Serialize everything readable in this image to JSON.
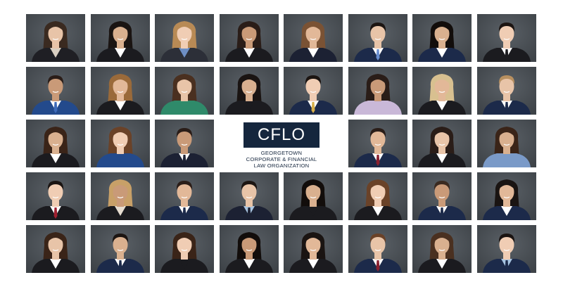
{
  "logo": {
    "wordmark": "CFLO",
    "subtitle_lines": [
      "GEORGETOWN",
      "CORPORATE & FINANCIAL",
      "LAW ORGANIZATION"
    ],
    "box_color": "#15263d"
  },
  "background_color": "#4b5157",
  "headshots": [
    {
      "hair": "#3a2a20",
      "hairStyle": "long",
      "suit": "#1f1f24",
      "shirt": "#d9cfc2",
      "tie": null
    },
    {
      "hair": "#1a1412",
      "hairStyle": "long",
      "suit": "#1b1b1f",
      "shirt": "#ffffff",
      "tie": null
    },
    {
      "hair": "#b88a55",
      "hairStyle": "long",
      "suit": "#2c2f38",
      "shirt": "#6e8fc4",
      "tie": null
    },
    {
      "hair": "#2a1d18",
      "hairStyle": "long",
      "suit": "#1b1b1f",
      "shirt": "#ffffff",
      "tie": null
    },
    {
      "hair": "#7a5234",
      "hairStyle": "long",
      "suit": "#1c2133",
      "shirt": "#ffffff",
      "tie": null
    },
    {
      "hair": "#1c1512",
      "hairStyle": "short",
      "suit": "#1c2a4a",
      "shirt": "#ffffff",
      "tie": "#6a8fd0"
    },
    {
      "hair": "#120d0b",
      "hairStyle": "long",
      "suit": "#1c2a4a",
      "shirt": "#ffffff",
      "tie": null
    },
    {
      "hair": "#1c1512",
      "hairStyle": "short",
      "suit": "#1b1b1f",
      "shirt": "#ffffff",
      "tie": "#1b1b1f"
    },
    {
      "hair": "#2a1d18",
      "hairStyle": "short",
      "suit": "#234a8c",
      "shirt": "#ffffff",
      "tie": "#3f6bb8"
    },
    {
      "hair": "#9a6a3a",
      "hairStyle": "long",
      "suit": "#1b1b1f",
      "shirt": "#ffffff",
      "tie": null
    },
    {
      "hair": "#4a3020",
      "hairStyle": "long",
      "suit": "#2f8a6a",
      "shirt": "#2f8a6a",
      "tie": null
    },
    {
      "hair": "#1a1412",
      "hairStyle": "long",
      "suit": "#1b1b1f",
      "shirt": "#1b1b1f",
      "tie": null
    },
    {
      "hair": "#1c1512",
      "hairStyle": "short",
      "suit": "#1c2a4a",
      "shirt": "#ffffff",
      "tie": "#d8b04a"
    },
    {
      "hair": "#2a1d18",
      "hairStyle": "long",
      "suit": "#c9b8d8",
      "shirt": "#c9b8d8",
      "tie": null
    },
    {
      "hair": "#d8c090",
      "hairStyle": "long",
      "suit": "#1b1b1f",
      "shirt": "#ffffff",
      "tie": null
    },
    {
      "hair": "#b89060",
      "hairStyle": "short",
      "suit": "#1c2a4a",
      "shirt": "#ffffff",
      "tie": "#1c2a4a"
    },
    {
      "hair": "#3a2418",
      "hairStyle": "long",
      "suit": "#1b1b1f",
      "shirt": "#ffffff",
      "tie": null
    },
    {
      "hair": "#6a4228",
      "hairStyle": "long",
      "suit": "#234a8c",
      "shirt": "#234a8c",
      "tie": null
    },
    {
      "hair": "#2a1d18",
      "hairStyle": "short",
      "suit": "#1c2133",
      "shirt": "#ffffff",
      "tie": "#1c2133"
    },
    {
      "hair": "#2a1d18",
      "hairStyle": "short",
      "suit": "#1c2a4a",
      "shirt": "#ffffff",
      "tie": "#8a2030"
    },
    {
      "hair": "#2a1d18",
      "hairStyle": "long",
      "suit": "#1b1b1f",
      "shirt": "#ffffff",
      "tie": null
    },
    {
      "hair": "#3a2418",
      "hairStyle": "long",
      "suit": "#7a9ac8",
      "shirt": "#7a9ac8",
      "tie": null
    },
    {
      "hair": "#1a1412",
      "hairStyle": "short",
      "suit": "#1b1b1f",
      "shirt": "#ffffff",
      "tie": "#a02030"
    },
    {
      "hair": "#c8a068",
      "hairStyle": "long",
      "suit": "#1b1b1f",
      "shirt": "#e6ddd0",
      "tie": null
    },
    {
      "hair": "#2a1d18",
      "hairStyle": "short",
      "suit": "#1c2a4a",
      "shirt": "#ffffff",
      "tie": "#1c2a4a"
    },
    {
      "hair": "#1c1512",
      "hairStyle": "short",
      "suit": "#1c2133",
      "shirt": "#a8c4e0",
      "tie": "#1c2133"
    },
    {
      "hair": "#120d0b",
      "hairStyle": "long",
      "suit": "#1b1b1f",
      "shirt": "#1b1b1f",
      "tie": null
    },
    {
      "hair": "#6a4228",
      "hairStyle": "long",
      "suit": "#1b1b1f",
      "shirt": "#ffffff",
      "tie": null
    },
    {
      "hair": "#3a2a20",
      "hairStyle": "short",
      "suit": "#1c2a4a",
      "shirt": "#ffffff",
      "tie": "#1c2a4a"
    },
    {
      "hair": "#1a1412",
      "hairStyle": "long",
      "suit": "#1c2a4a",
      "shirt": "#ffffff",
      "tie": null
    },
    {
      "hair": "#3a2418",
      "hairStyle": "long",
      "suit": "#1b1b1f",
      "shirt": "#ffffff",
      "tie": null
    },
    {
      "hair": "#1c1512",
      "hairStyle": "short",
      "suit": "#1c2a4a",
      "shirt": "#ffffff",
      "tie": "#1c2a4a"
    },
    {
      "hair": "#3a2418",
      "hairStyle": "long",
      "suit": "#1b1b1f",
      "shirt": "#1b1b1f",
      "tie": null
    },
    {
      "hair": "#120d0b",
      "hairStyle": "long",
      "suit": "#1b1b1f",
      "shirt": "#ffffff",
      "tie": null
    },
    {
      "hair": "#1a1412",
      "hairStyle": "long",
      "suit": "#1b1b1f",
      "shirt": "#ffffff",
      "tie": null
    },
    {
      "hair": "#6a4228",
      "hairStyle": "short",
      "suit": "#1c2a4a",
      "shirt": "#ffffff",
      "tie": "#8a2030"
    },
    {
      "hair": "#4a3020",
      "hairStyle": "long",
      "suit": "#1b1b1f",
      "shirt": "#ffffff",
      "tie": null
    },
    {
      "hair": "#1a1412",
      "hairStyle": "short",
      "suit": "#1c2a4a",
      "shirt": "#a8c4e0",
      "tie": "#1c2a4a"
    }
  ]
}
